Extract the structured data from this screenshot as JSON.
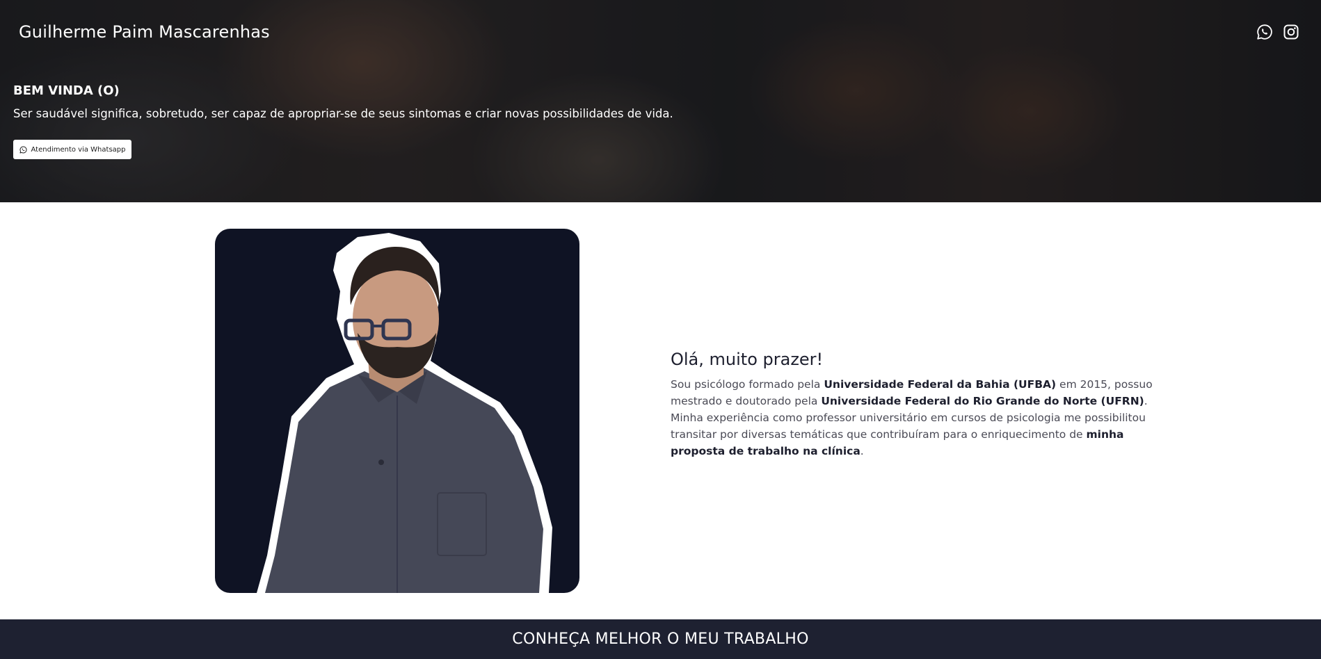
{
  "header": {
    "site_title": "Guilherme Paim Mascarenhas",
    "social": [
      {
        "icon": "whatsapp-icon"
      },
      {
        "icon": "instagram-icon"
      }
    ]
  },
  "hero": {
    "heading": "BEM VINDA (O)",
    "text": "Ser saudável significa, sobretudo, ser capaz de apropriar-se de seus sintomas e criar novas possibilidades de vida.",
    "button_label": "Atendimento via Whatsapp",
    "button_icon": "whatsapp-icon"
  },
  "about": {
    "heading": "Olá, muito prazer!",
    "p1": "Sou psicólogo formado pela ",
    "b1": "Universidade Federal da Bahia (UFBA)",
    "p2": " em 2015, possuo mestrado e doutorado pela ",
    "b2": "Universidade Federal do Rio Grande do Norte (UFRN)",
    "p3": ". Minha experiência como professor universitário em cursos de psicologia me possibilitou transitar por diversas temáticas que contribuíram para o enriquecimento de ",
    "b3": "minha proposta de trabalho na clínica",
    "p4": "."
  },
  "section_band": {
    "title": "CONHEÇA MELHOR O MEU TRABALHO"
  },
  "colors": {
    "dark_navy": "#1e2131",
    "photo_bg": "#0f1324",
    "shirt": "#454857"
  }
}
